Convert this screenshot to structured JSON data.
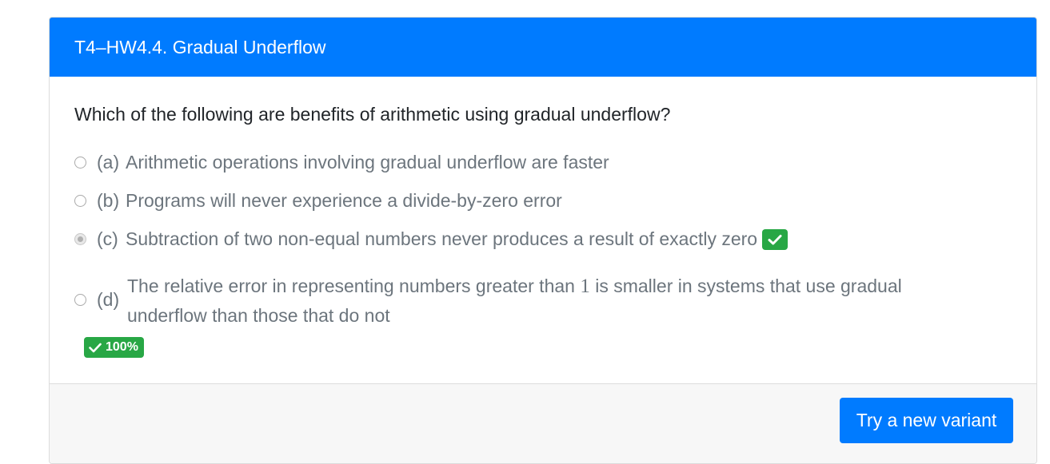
{
  "header": {
    "title": "T4–HW4.4. Gradual Underflow"
  },
  "question": {
    "text": "Which of the following are benefits of arithmetic using gradual underflow?"
  },
  "options": [
    {
      "key": "(a)",
      "text": "Arithmetic operations involving gradual underflow are faster",
      "selected": false
    },
    {
      "key": "(b)",
      "text": "Programs will never experience a divide-by-zero error",
      "selected": false
    },
    {
      "key": "(c)",
      "text": "Subtraction of two non-equal numbers never produces a result of exactly zero",
      "selected": true,
      "correct_icon": "check-icon"
    },
    {
      "key": "(d)",
      "text_before": "The relative error in representing numbers greater than ",
      "text_number": "1",
      "text_after": " is smaller in systems that use gradual underflow than those that do not",
      "selected": false
    }
  ],
  "score": {
    "label": "100%",
    "icon": "check-icon",
    "color": "#28a745"
  },
  "footer": {
    "button_label": "Try a new variant"
  },
  "colors": {
    "primary": "#007bff",
    "success": "#28a745",
    "muted_text": "#6c757d",
    "footer_bg": "#f7f7f7"
  }
}
